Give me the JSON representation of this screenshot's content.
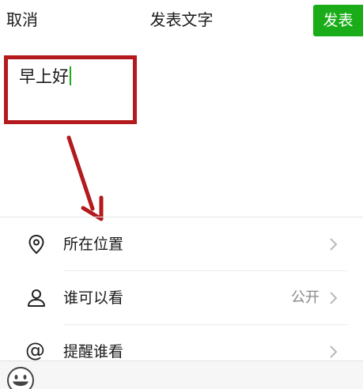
{
  "header": {
    "cancel_label": "取消",
    "title": "发表文字",
    "publish_label": "发表"
  },
  "composer": {
    "text": "早上好"
  },
  "options": [
    {
      "label": "所在位置",
      "value": "",
      "icon": "location-pin-icon"
    },
    {
      "label": "谁可以看",
      "value": "公开",
      "icon": "person-icon"
    },
    {
      "label": "提醒谁看",
      "value": "",
      "icon": "at-icon"
    }
  ],
  "bottom_bar": {
    "icon": "emoji-icon"
  },
  "colors": {
    "accent": "#1aad19",
    "annotation": "#b3191d"
  }
}
